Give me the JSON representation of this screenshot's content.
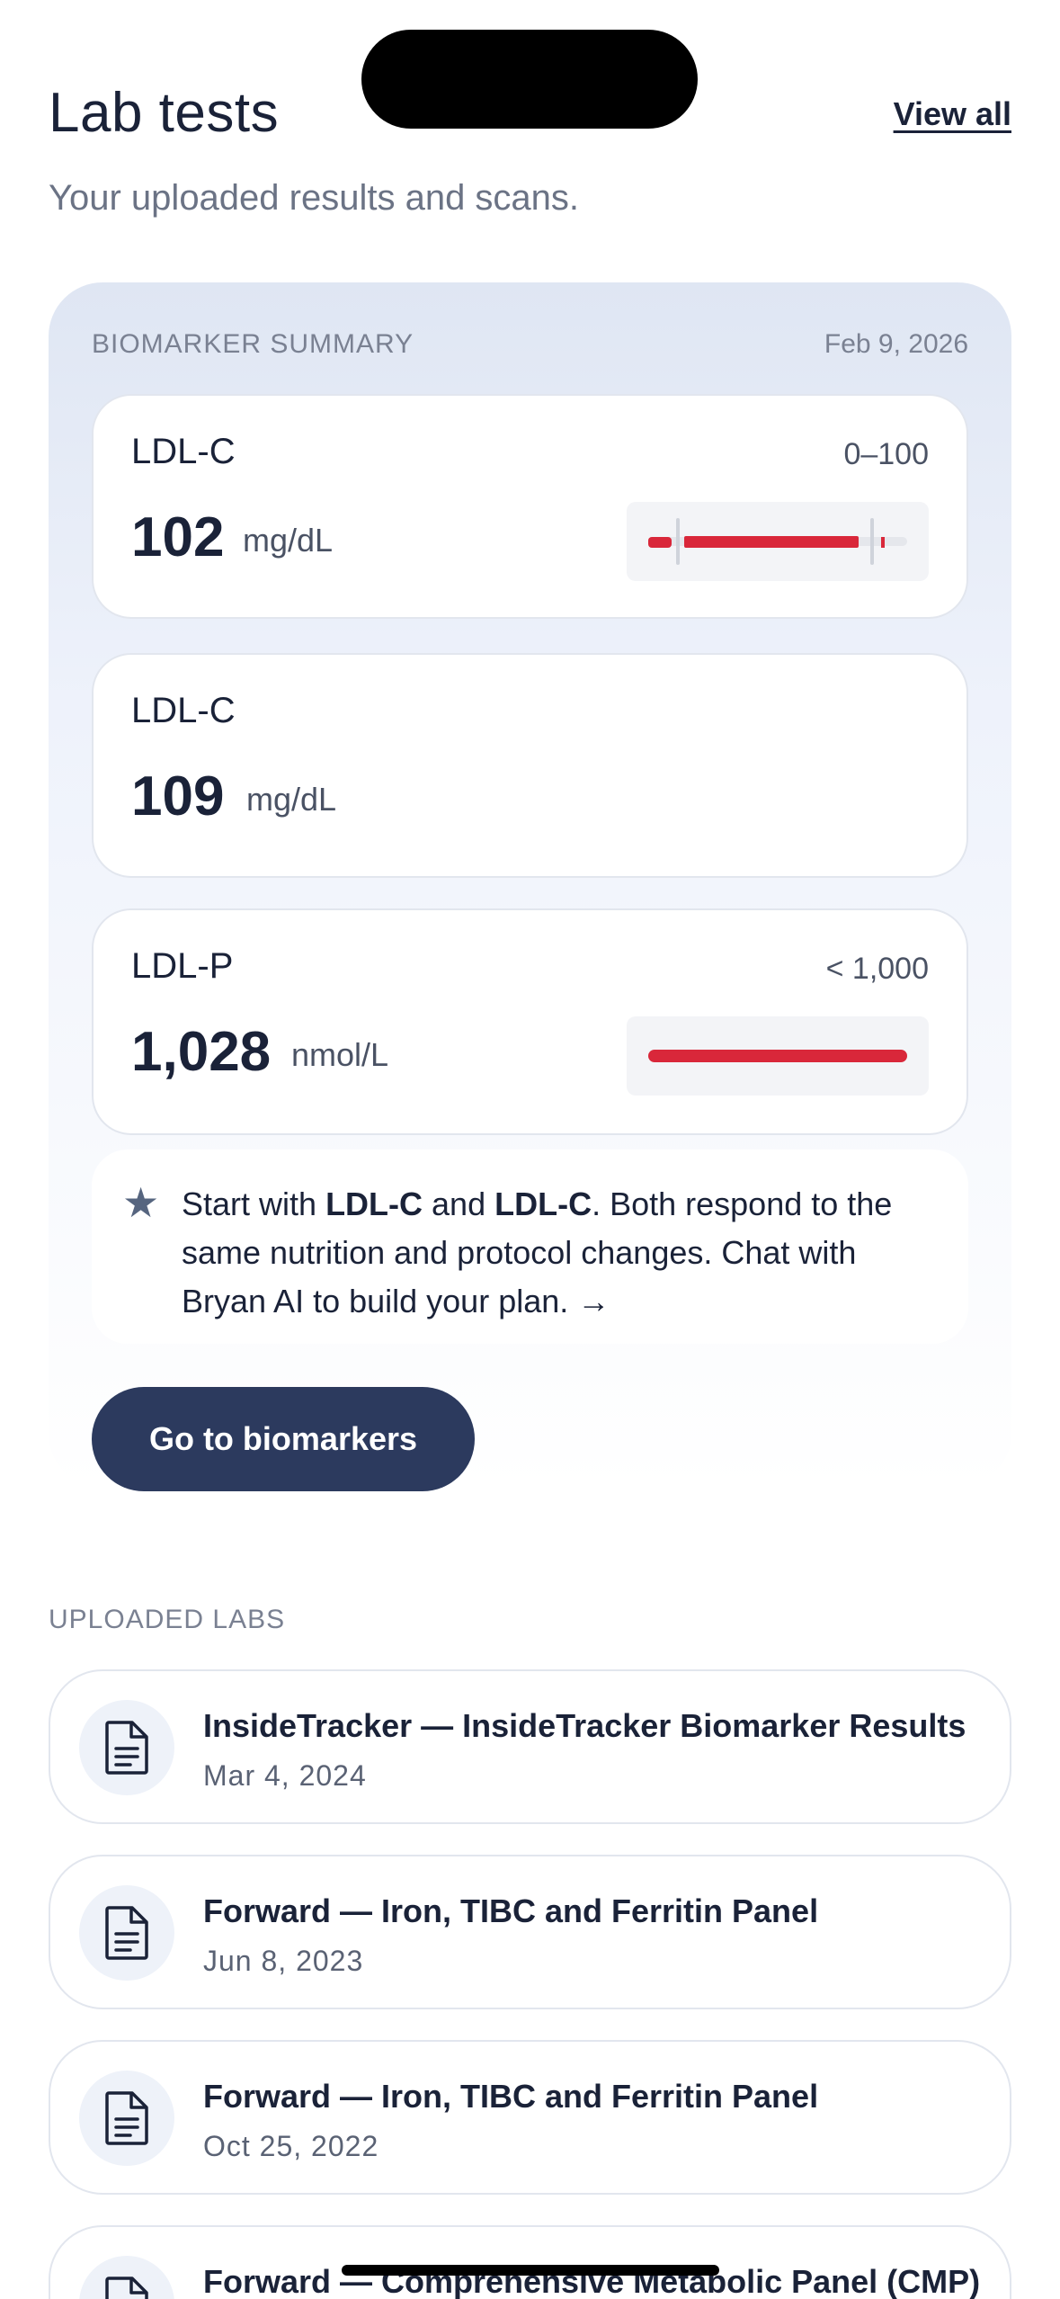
{
  "header": {
    "title": "Lab tests",
    "view_all": "View all",
    "subtitle": "Your uploaded results and scans."
  },
  "summary": {
    "label": "BIOMARKER SUMMARY",
    "date": "Feb 9, 2026",
    "cards": [
      {
        "name": "LDL-C",
        "range": "0–100",
        "value": "102",
        "unit": "mg/dL"
      },
      {
        "name": "LDL-C",
        "range": "",
        "value": "109",
        "unit": "mg/dL"
      },
      {
        "name": "LDL-P",
        "range": "< 1,000",
        "value": "1,028",
        "unit": "nmol/L"
      }
    ],
    "tip": {
      "pre": "Start with ",
      "bold1": "LDL-C",
      "mid": " and ",
      "bold2": "LDL-C",
      "post": ". Both respond to the same nutrition and protocol changes. Chat with Bryan AI to build your plan. →"
    },
    "cta": "Go to biomarkers"
  },
  "uploaded": {
    "label": "UPLOADED LABS",
    "items": [
      {
        "title": "InsideTracker — InsideTracker Biomarker Results",
        "date": "Mar 4, 2024"
      },
      {
        "title": "Forward — Iron, TIBC and Ferritin Panel",
        "date": "Jun 8, 2023"
      },
      {
        "title": "Forward — Iron, TIBC and Ferritin Panel",
        "date": "Oct 25, 2022"
      },
      {
        "title": "Forward — Comprehensive Metabolic Panel (CMP)",
        "date": ""
      }
    ]
  },
  "colors": {
    "accent": "#2c3a5e",
    "alert": "#d9273a",
    "text": "#1a2238",
    "muted": "#7a8192"
  }
}
